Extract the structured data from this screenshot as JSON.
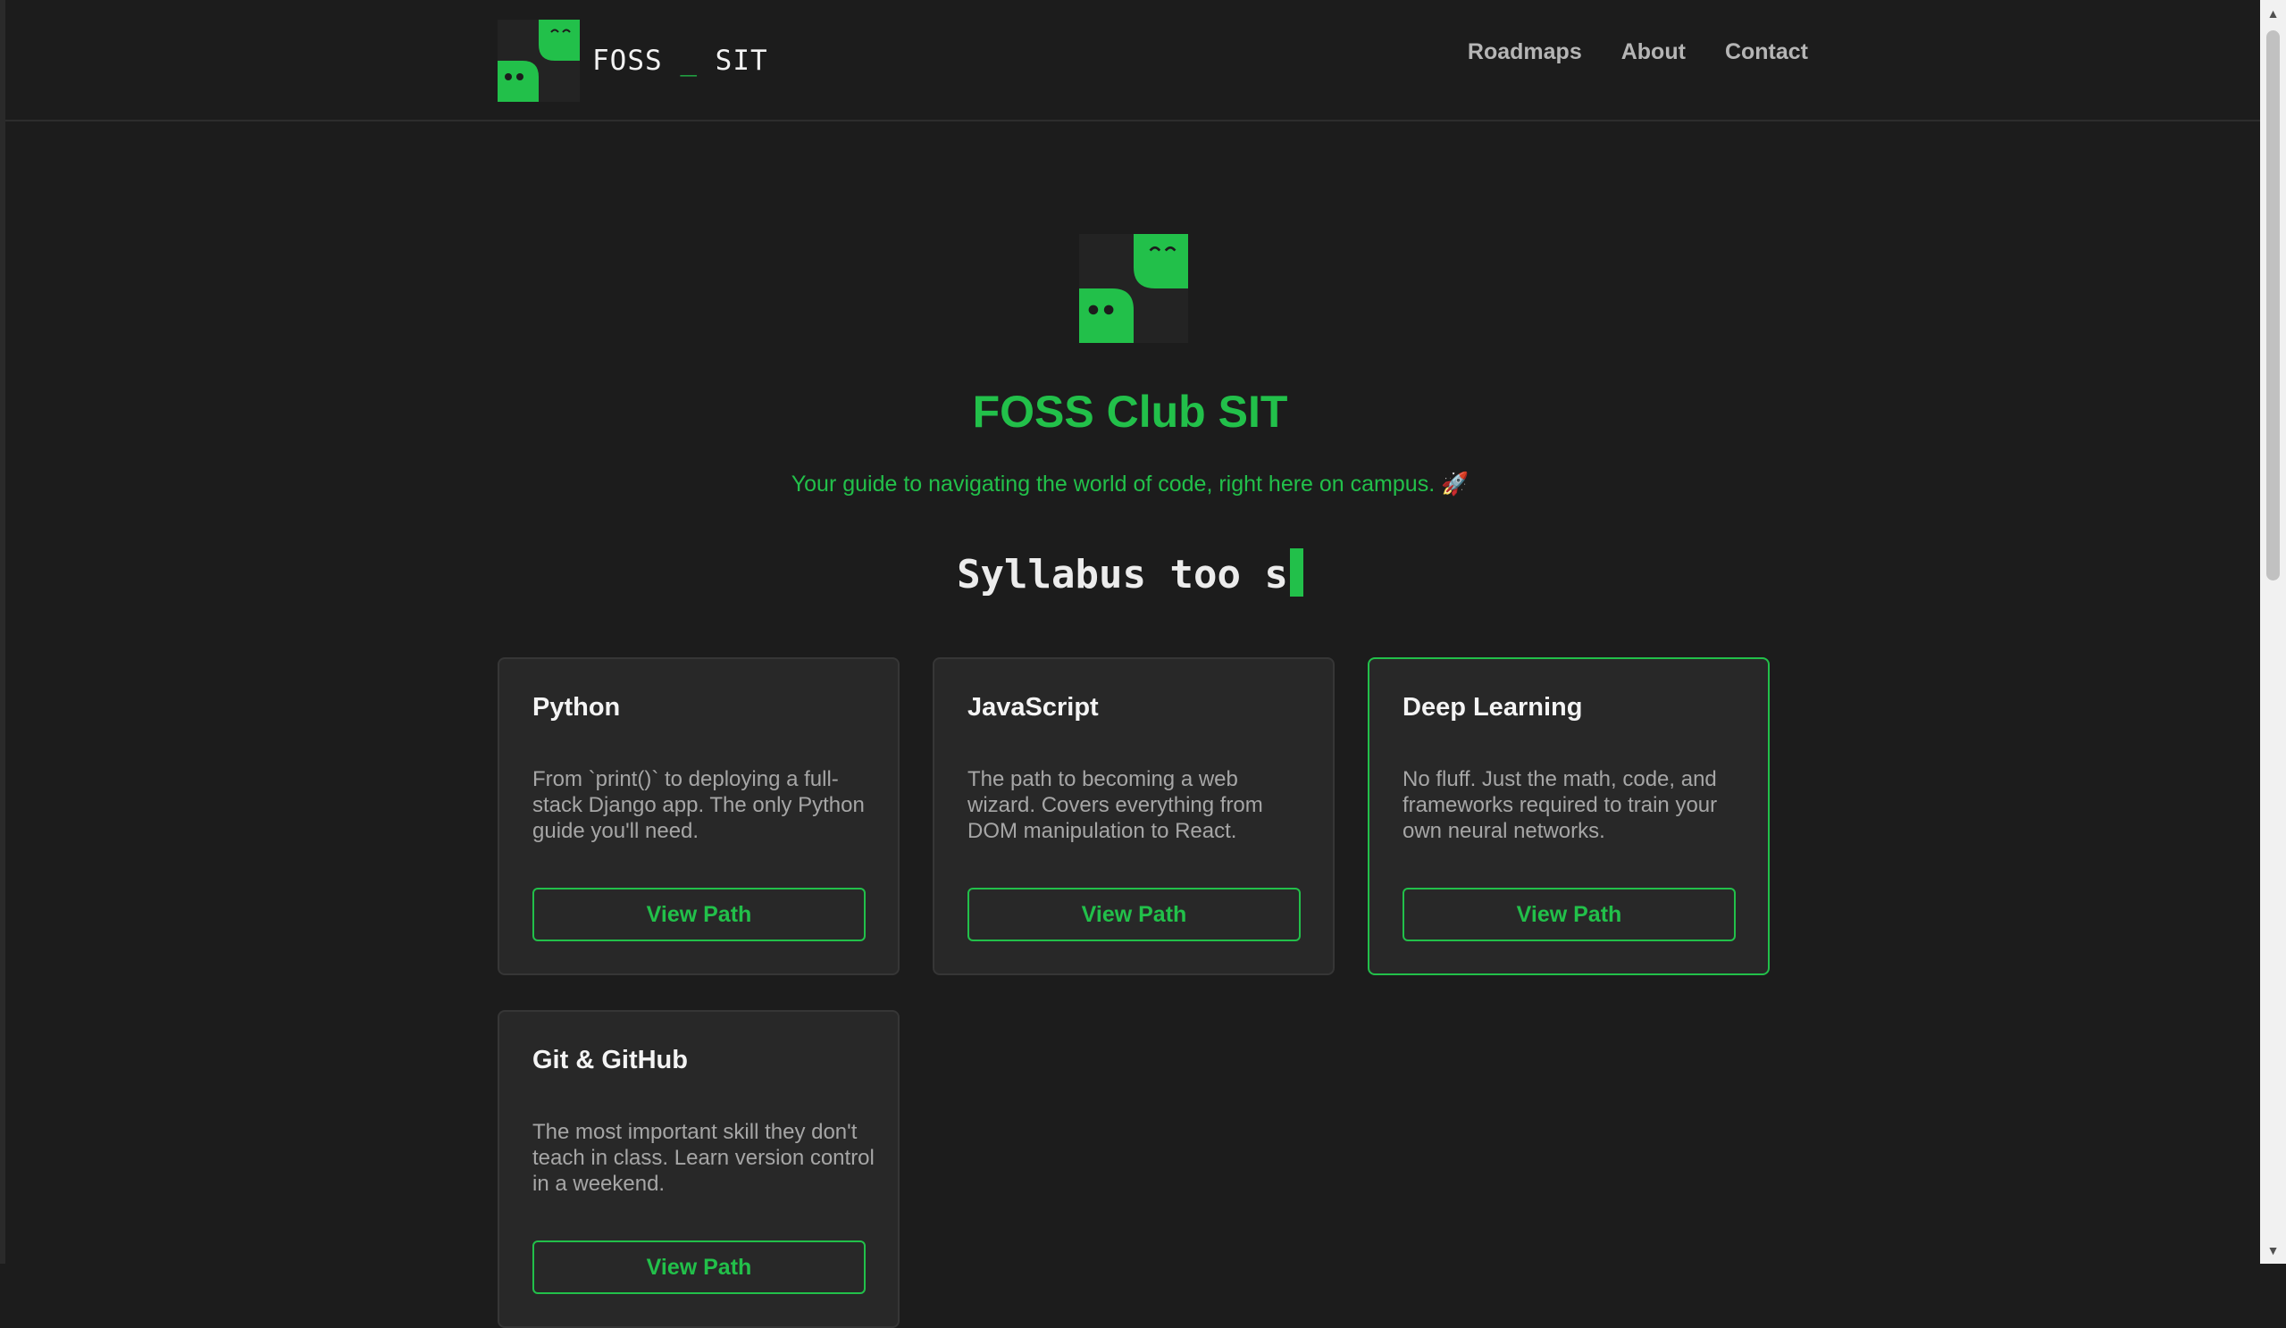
{
  "navbar": {
    "brand_name": "FOSS",
    "brand_sep": "_",
    "brand_suffix": "SIT",
    "links": [
      "Roadmaps",
      "About",
      "Contact"
    ]
  },
  "hero": {
    "title": "FOSS Club SIT",
    "subtitle": "Your guide to navigating the world of code, right here on campus. 🚀",
    "typed_text": "Syllabus too s"
  },
  "cards": [
    {
      "title": "Python",
      "description": "From `print()` to deploying a full-stack Django app. The only Python guide you'll need.",
      "button": "View Path"
    },
    {
      "title": "JavaScript",
      "description": "The path to becoming a web wizard. Covers everything from DOM manipulation to React.",
      "button": "View Path"
    },
    {
      "title": "Deep Learning",
      "description": "No fluff. Just the math, code, and frameworks required to train your own neural networks.",
      "button": "View Path"
    },
    {
      "title": "Git & GitHub",
      "description": "The most important skill they don't teach in class. Learn version control in a weekend.",
      "button": "View Path"
    }
  ],
  "colors": {
    "accent": "#22c04a",
    "background": "#1c1c1c",
    "card": "#282828"
  },
  "icons": {
    "logo": "foss-ghost-logo-icon",
    "scroll_up": "chevron-up-icon",
    "scroll_down": "chevron-down-icon"
  }
}
